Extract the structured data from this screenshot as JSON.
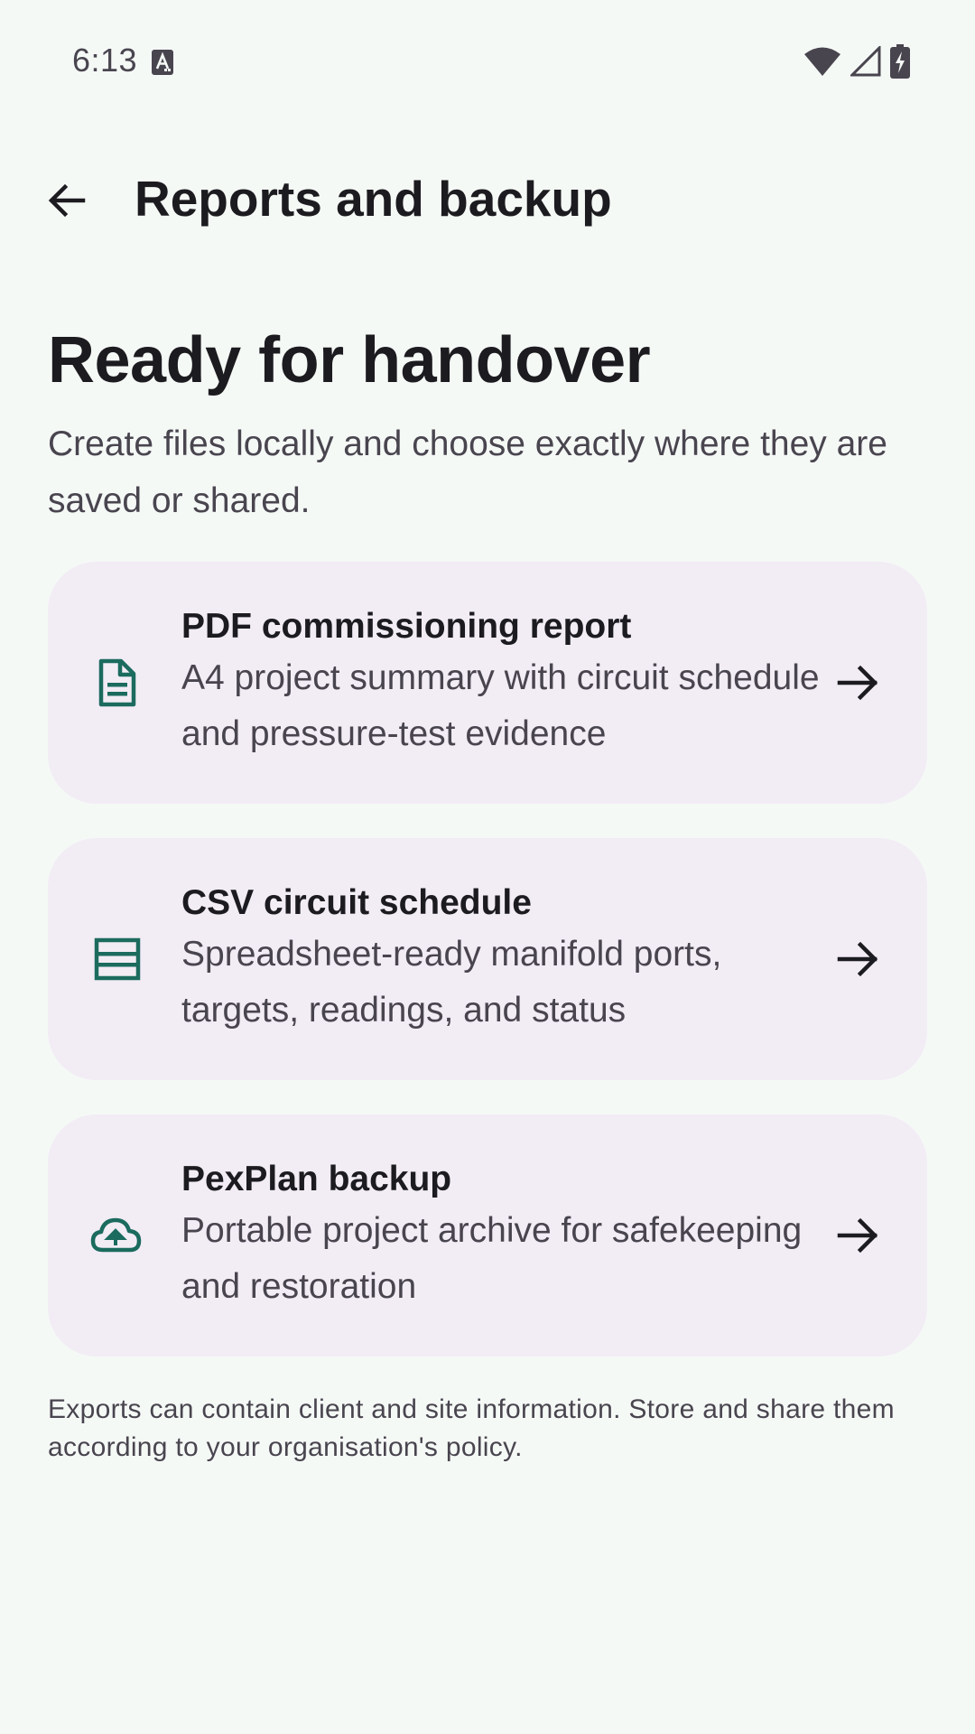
{
  "status_bar": {
    "time": "6:13",
    "icons": [
      "keyboard-a-icon",
      "wifi-icon",
      "cell-signal-icon",
      "battery-charging-icon"
    ]
  },
  "app_bar": {
    "title": "Reports and backup",
    "back_icon": "arrow-back-icon"
  },
  "header": {
    "title": "Ready for handover",
    "subtitle": "Create files locally and choose exactly where they are saved or shared."
  },
  "cards": [
    {
      "icon": "document-icon",
      "title": "PDF commissioning report",
      "description": "A4 project summary with circuit schedule and pressure-test evidence"
    },
    {
      "icon": "table-icon",
      "title": "CSV circuit schedule",
      "description": "Spreadsheet-ready manifold ports, targets, readings, and status"
    },
    {
      "icon": "cloud-upload-icon",
      "title": "PexPlan backup",
      "description": "Portable project archive for safekeeping and restoration"
    }
  ],
  "footnote": "Exports can contain client and site information. Store and share them according to your organisation's policy.",
  "colors": {
    "background": "#f5f9f6",
    "card": "#f2ecf5",
    "accent": "#1b6b5e",
    "text_primary": "#1c1b1f",
    "text_secondary": "#49454f"
  }
}
